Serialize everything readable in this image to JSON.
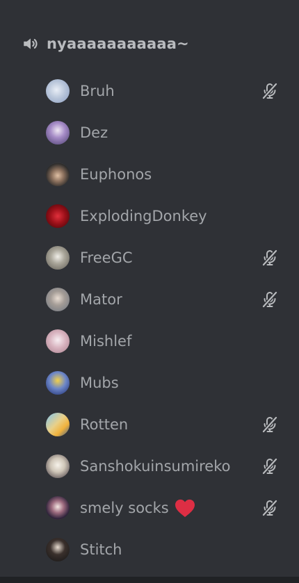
{
  "channel": {
    "name": "nyaaaaaaaaaaa~",
    "icon": "speaker-icon"
  },
  "members": [
    {
      "name": "Bruh",
      "muted": true,
      "avatar": "av-bruh"
    },
    {
      "name": "Dez",
      "muted": false,
      "avatar": "av-dez"
    },
    {
      "name": "Euphonos",
      "muted": false,
      "avatar": "av-euph"
    },
    {
      "name": "ExplodingDonkey",
      "muted": false,
      "avatar": "av-expl"
    },
    {
      "name": "FreeGC",
      "muted": true,
      "avatar": "av-free"
    },
    {
      "name": "Mator",
      "muted": true,
      "avatar": "av-mator"
    },
    {
      "name": "Mishlef",
      "muted": false,
      "avatar": "av-mish"
    },
    {
      "name": "Mubs",
      "muted": false,
      "avatar": "av-mubs"
    },
    {
      "name": "Rotten",
      "muted": true,
      "avatar": "av-rotten"
    },
    {
      "name": "Sanshokuinsumireko",
      "muted": true,
      "avatar": "av-sansh"
    },
    {
      "name": "smely socks",
      "muted": true,
      "avatar": "av-smely",
      "suffix_icon": "heart-icon"
    },
    {
      "name": "Stitch",
      "muted": false,
      "avatar": "av-stitch"
    }
  ],
  "colors": {
    "background": "#2f3136",
    "channel_text": "#b9bbbe",
    "member_text": "#a3a6aa",
    "icon": "#b9bbbe",
    "heart": "#dd2e44"
  }
}
